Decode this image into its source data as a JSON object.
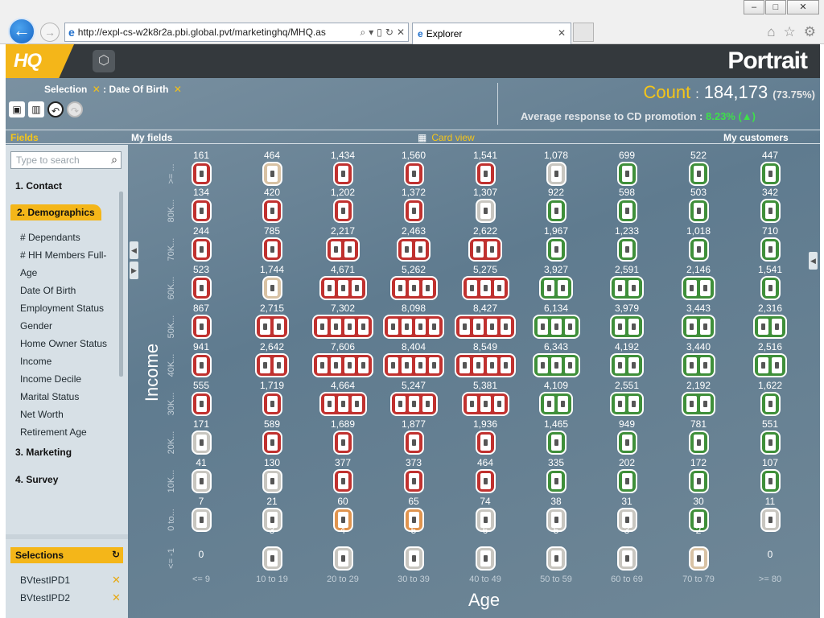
{
  "browser": {
    "url": "http://expl-cs-w2k8r2a.pbi.global.pvt/marketinghq/MHQ.as",
    "tab_title": "Explorer"
  },
  "app": {
    "logo": "HQ",
    "brand": "Portrait"
  },
  "selection": {
    "label": "Selection",
    "sep": ":",
    "item": "Date Of Birth"
  },
  "stats": {
    "count_label": "Count",
    "count_value": "184,173",
    "count_pct": "(73.75%)",
    "response_label": "Average response to CD promotion",
    "response_value": "8.23% (▲)"
  },
  "headers": {
    "fields": "Fields",
    "my_fields": "My fields",
    "card_view": "Card view",
    "my_customers": "My customers"
  },
  "sidebar": {
    "search_placeholder": "Type to search",
    "categories": [
      "1. Contact",
      "2. Demographics",
      "3. Marketing",
      "4. Survey"
    ],
    "fields": [
      "# Dependants",
      "# HH Members Full-",
      "Age",
      "Date Of Birth",
      "Employment Status",
      "Gender",
      "Home Owner Status",
      "Income",
      "Income Decile",
      "Marital Status",
      "Net Worth",
      "Retirement Age"
    ],
    "selections_label": "Selections",
    "selections": [
      "BVtestIPD1",
      "BVtestIPD2"
    ]
  },
  "axes": {
    "y_label": "Income",
    "x_label": "Age",
    "y_ticks": [
      ">= ...",
      "80K...",
      "70K...",
      "60K...",
      "50K...",
      "40K...",
      "30K...",
      "20K...",
      "10K...",
      "0 to...",
      "<= -1"
    ],
    "x_ticks": [
      "<= 9",
      "10 to 19",
      "20 to 29",
      "30 to 39",
      "40 to 49",
      "50 to 59",
      "60 to 69",
      "70 to 79",
      ">= 80"
    ]
  },
  "grid": {
    "counts": [
      [
        "161",
        "464",
        "1,434",
        "1,560",
        "1,541",
        "1,078",
        "699",
        "522",
        "447"
      ],
      [
        "134",
        "420",
        "1,202",
        "1,372",
        "1,307",
        "922",
        "598",
        "503",
        "342"
      ],
      [
        "244",
        "785",
        "2,217",
        "2,463",
        "2,622",
        "1,967",
        "1,233",
        "1,018",
        "710"
      ],
      [
        "523",
        "1,744",
        "4,671",
        "5,262",
        "5,275",
        "3,927",
        "2,591",
        "2,146",
        "1,541"
      ],
      [
        "867",
        "2,715",
        "7,302",
        "8,098",
        "8,427",
        "6,134",
        "3,979",
        "3,443",
        "2,316"
      ],
      [
        "941",
        "2,642",
        "7,606",
        "8,404",
        "8,549",
        "6,343",
        "4,192",
        "3,440",
        "2,516"
      ],
      [
        "555",
        "1,719",
        "4,664",
        "5,247",
        "5,381",
        "4,109",
        "2,551",
        "2,192",
        "1,622"
      ],
      [
        "171",
        "589",
        "1,689",
        "1,877",
        "1,936",
        "1,465",
        "949",
        "781",
        "551"
      ],
      [
        "41",
        "130",
        "377",
        "373",
        "464",
        "335",
        "202",
        "172",
        "107"
      ],
      [
        "7",
        "21",
        "60",
        "65",
        "74",
        "38",
        "31",
        "30",
        "11"
      ],
      [
        "0",
        "3",
        "4",
        "5",
        "6",
        "5",
        "3",
        "2",
        "0"
      ]
    ],
    "colors": [
      [
        "r",
        "b",
        "r",
        "r",
        "r",
        "w",
        "g",
        "g",
        "g"
      ],
      [
        "r",
        "r",
        "r",
        "r",
        "w",
        "g",
        "g",
        "g",
        "g"
      ],
      [
        "r",
        "r",
        "r",
        "r",
        "r",
        "g",
        "g",
        "g",
        "g"
      ],
      [
        "r",
        "b",
        "r",
        "r",
        "r",
        "g",
        "g",
        "g",
        "g"
      ],
      [
        "r",
        "r",
        "r",
        "r",
        "r",
        "g",
        "g",
        "g",
        "g"
      ],
      [
        "r",
        "r",
        "r",
        "r",
        "r",
        "g",
        "g",
        "g",
        "g"
      ],
      [
        "r",
        "r",
        "r",
        "r",
        "r",
        "g",
        "g",
        "g",
        "g"
      ],
      [
        "w",
        "r",
        "r",
        "r",
        "r",
        "g",
        "g",
        "g",
        "g"
      ],
      [
        "w",
        "w",
        "r",
        "r",
        "r",
        "g",
        "g",
        "g",
        "g"
      ],
      [
        "w",
        "w",
        "o",
        "o",
        "w",
        "w",
        "w",
        "g",
        "w"
      ],
      [
        "",
        "w",
        "w",
        "w",
        "w",
        "w",
        "w",
        "b",
        ""
      ]
    ],
    "cards": [
      [
        1,
        1,
        1,
        1,
        1,
        1,
        1,
        1,
        1
      ],
      [
        1,
        1,
        1,
        1,
        1,
        1,
        1,
        1,
        1
      ],
      [
        1,
        1,
        2,
        2,
        2,
        1,
        1,
        1,
        1
      ],
      [
        1,
        1,
        3,
        3,
        3,
        2,
        2,
        2,
        1
      ],
      [
        1,
        2,
        4,
        4,
        4,
        3,
        2,
        2,
        2
      ],
      [
        1,
        2,
        4,
        4,
        4,
        3,
        2,
        2,
        2
      ],
      [
        1,
        1,
        3,
        3,
        3,
        2,
        2,
        2,
        1
      ],
      [
        1,
        1,
        1,
        1,
        1,
        1,
        1,
        1,
        1
      ],
      [
        1,
        1,
        1,
        1,
        1,
        1,
        1,
        1,
        1
      ],
      [
        1,
        1,
        1,
        1,
        1,
        1,
        1,
        1,
        1
      ],
      [
        0,
        1,
        1,
        1,
        1,
        1,
        1,
        1,
        0
      ]
    ]
  }
}
